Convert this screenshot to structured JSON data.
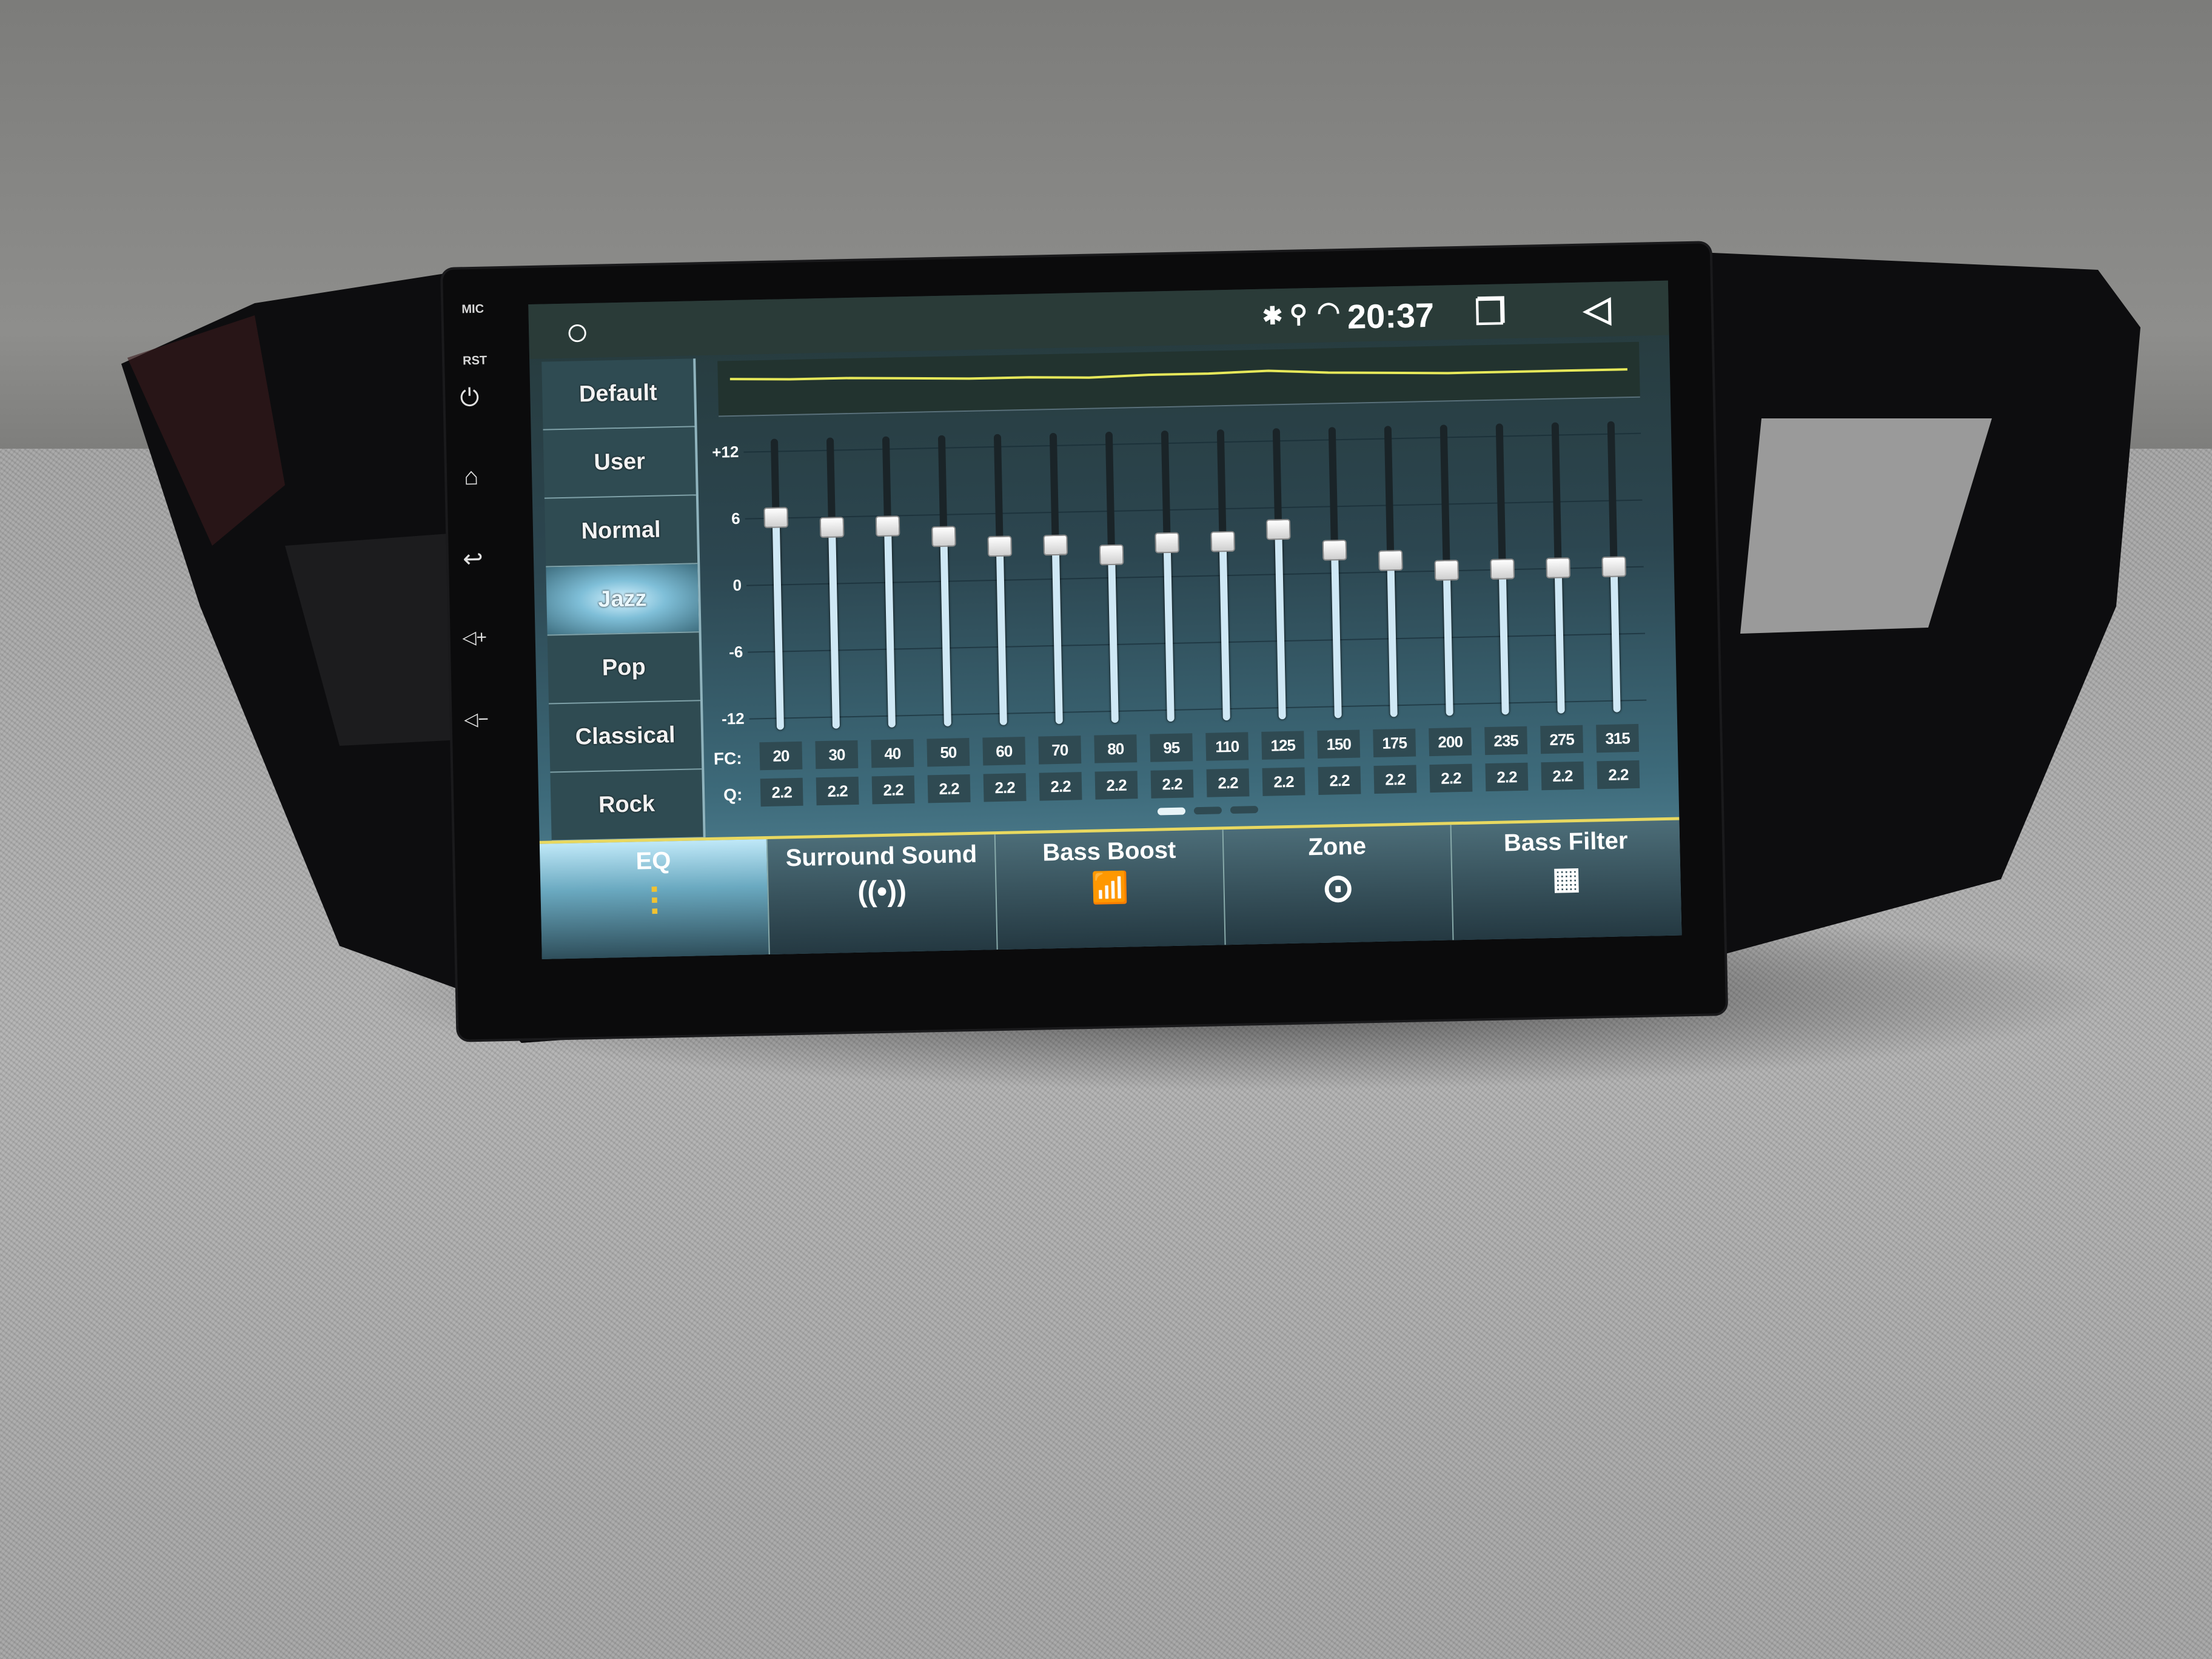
{
  "bezel": {
    "mic_label": "MIC",
    "rst_label": "RST",
    "buttons": [
      {
        "icon": "power-icon",
        "glyph": "⏻"
      },
      {
        "icon": "home-icon",
        "glyph": "⌂"
      },
      {
        "icon": "back-icon",
        "glyph": "↩"
      },
      {
        "icon": "volume-up-icon",
        "glyph": "◁+"
      },
      {
        "icon": "volume-down-icon",
        "glyph": "◁−"
      }
    ]
  },
  "status_bar": {
    "home_glyph": "○",
    "icons": {
      "bluetooth": "✱",
      "location": "⚲",
      "wifi": "◠"
    },
    "time": "20:37",
    "recents_glyph": "❐",
    "back_glyph": "◁"
  },
  "presets": {
    "items": [
      "Default",
      "User",
      "Normal",
      "Jazz",
      "Pop",
      "Classical",
      "Rock"
    ],
    "selected": "Jazz"
  },
  "eq": {
    "y_ticks": [
      "+12",
      "6",
      "0",
      "-6",
      "-12"
    ],
    "fc_label": "FC:",
    "q_label": "Q:",
    "bands": [
      {
        "fc": "20",
        "q": "2.2",
        "gain": 6
      },
      {
        "fc": "30",
        "q": "2.2",
        "gain": 5
      },
      {
        "fc": "40",
        "q": "2.2",
        "gain": 5
      },
      {
        "fc": "50",
        "q": "2.2",
        "gain": 4
      },
      {
        "fc": "60",
        "q": "2.2",
        "gain": 3
      },
      {
        "fc": "70",
        "q": "2.2",
        "gain": 3
      },
      {
        "fc": "80",
        "q": "2.2",
        "gain": 2
      },
      {
        "fc": "95",
        "q": "2.2",
        "gain": 3
      },
      {
        "fc": "110",
        "q": "2.2",
        "gain": 3
      },
      {
        "fc": "125",
        "q": "2.2",
        "gain": 4
      },
      {
        "fc": "150",
        "q": "2.2",
        "gain": 2
      },
      {
        "fc": "175",
        "q": "2.2",
        "gain": 1
      },
      {
        "fc": "200",
        "q": "2.2",
        "gain": 0
      },
      {
        "fc": "235",
        "q": "2.2",
        "gain": 0
      },
      {
        "fc": "275",
        "q": "2.2",
        "gain": 0
      },
      {
        "fc": "315",
        "q": "2.2",
        "gain": 0
      }
    ],
    "gain_range": [
      -12,
      12
    ],
    "page": 1,
    "pages": 3,
    "curve_color": "#e6e85a",
    "track_color": "#cfe8f5"
  },
  "tabs": [
    {
      "label": "EQ",
      "icon": "equalizer-icon",
      "glyph": "⫶",
      "selected": true
    },
    {
      "label": "Surround Sound",
      "icon": "surround-icon",
      "glyph": "((•))",
      "selected": false
    },
    {
      "label": "Bass Boost",
      "icon": "bass-boost-icon",
      "glyph": "📶",
      "selected": false
    },
    {
      "label": "Zone",
      "icon": "zone-icon",
      "glyph": "⊙",
      "selected": false
    },
    {
      "label": "Bass Filter",
      "icon": "bass-filter-icon",
      "glyph": "▦",
      "selected": false
    }
  ]
}
